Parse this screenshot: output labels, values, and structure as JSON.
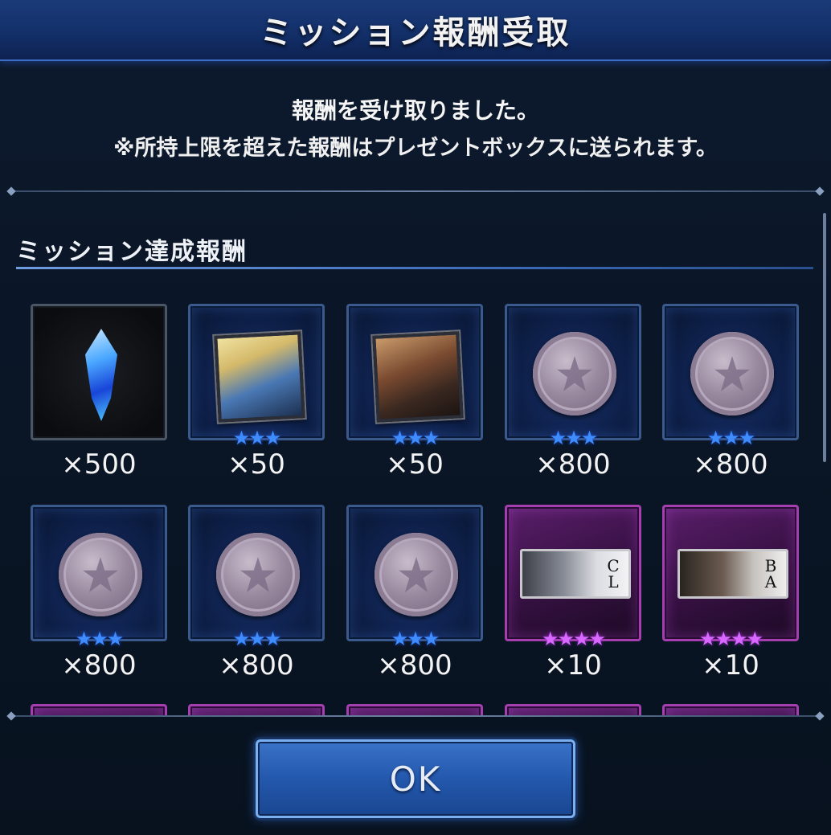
{
  "dialog": {
    "title": "ミッション報酬受取",
    "message_line1": "報酬を受け取りました。",
    "message_line2": "※所持上限を超えた報酬はプレゼントボックスに送られます。",
    "section_title": "ミッション達成報酬",
    "ok_label": "OK"
  },
  "colors": {
    "title_bar": "#13306a",
    "frame_blue": "#3a5a8e",
    "frame_purple": "#a53fb0",
    "star_blue": "#3f8cff",
    "star_pink": "#d868ff",
    "ok_button": "#2358ad"
  },
  "rewards": [
    {
      "icon": "crystal-icon",
      "stars": "",
      "star_color": "",
      "qty": "×500"
    },
    {
      "icon": "cloud-portrait-icon",
      "stars": "★★★",
      "star_color": "blue",
      "qty": "×50"
    },
    {
      "icon": "barret-portrait-icon",
      "stars": "★★★",
      "star_color": "blue",
      "qty": "×50"
    },
    {
      "icon": "coin-icon",
      "stars": "★★★",
      "star_color": "blue",
      "qty": "×800"
    },
    {
      "icon": "coin-icon",
      "stars": "★★★",
      "star_color": "blue",
      "qty": "×800"
    },
    {
      "icon": "coin-icon",
      "stars": "★★★",
      "star_color": "blue",
      "qty": "×800"
    },
    {
      "icon": "coin-icon",
      "stars": "★★★",
      "star_color": "blue",
      "qty": "×800"
    },
    {
      "icon": "coin-icon",
      "stars": "★★★",
      "star_color": "blue",
      "qty": "×800"
    },
    {
      "icon": "cloud-ticket-icon",
      "code": "CL",
      "stars": "★★★★",
      "star_color": "pink",
      "qty": "×10"
    },
    {
      "icon": "barret-ticket-icon",
      "code": "BA",
      "stars": "★★★★",
      "star_color": "pink",
      "qty": "×10"
    }
  ]
}
